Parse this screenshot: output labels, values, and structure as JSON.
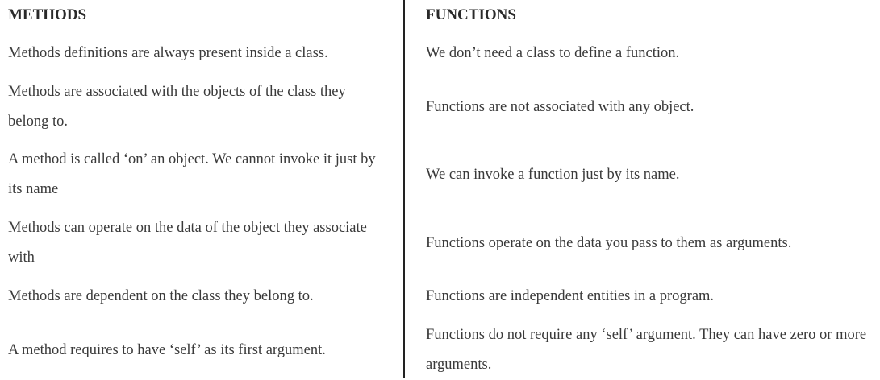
{
  "table": {
    "headers": {
      "left": "METHODS",
      "right": "FUNCTIONS"
    },
    "rows": [
      {
        "method": "Methods definitions are always present inside a class.",
        "function": "We don’t need a class to define a function."
      },
      {
        "method": "Methods are associated with the objects of the class they belong to.",
        "function": "Functions are not associated with any object."
      },
      {
        "method": "A method is called ‘on’ an object. We cannot invoke it just by its name",
        "function": "We can invoke a function just by its name."
      },
      {
        "method": "Methods can operate on the data of the object they associate with",
        "function": "Functions operate on the data you pass to them as arguments."
      },
      {
        "method": "Methods are dependent on the class they belong to.",
        "function": "Functions are independent entities in a program."
      },
      {
        "method": "A method requires to have ‘self’ as its first argument.",
        "function": "Functions do not require any ‘self’ argument. They can have zero or more arguments."
      }
    ]
  }
}
